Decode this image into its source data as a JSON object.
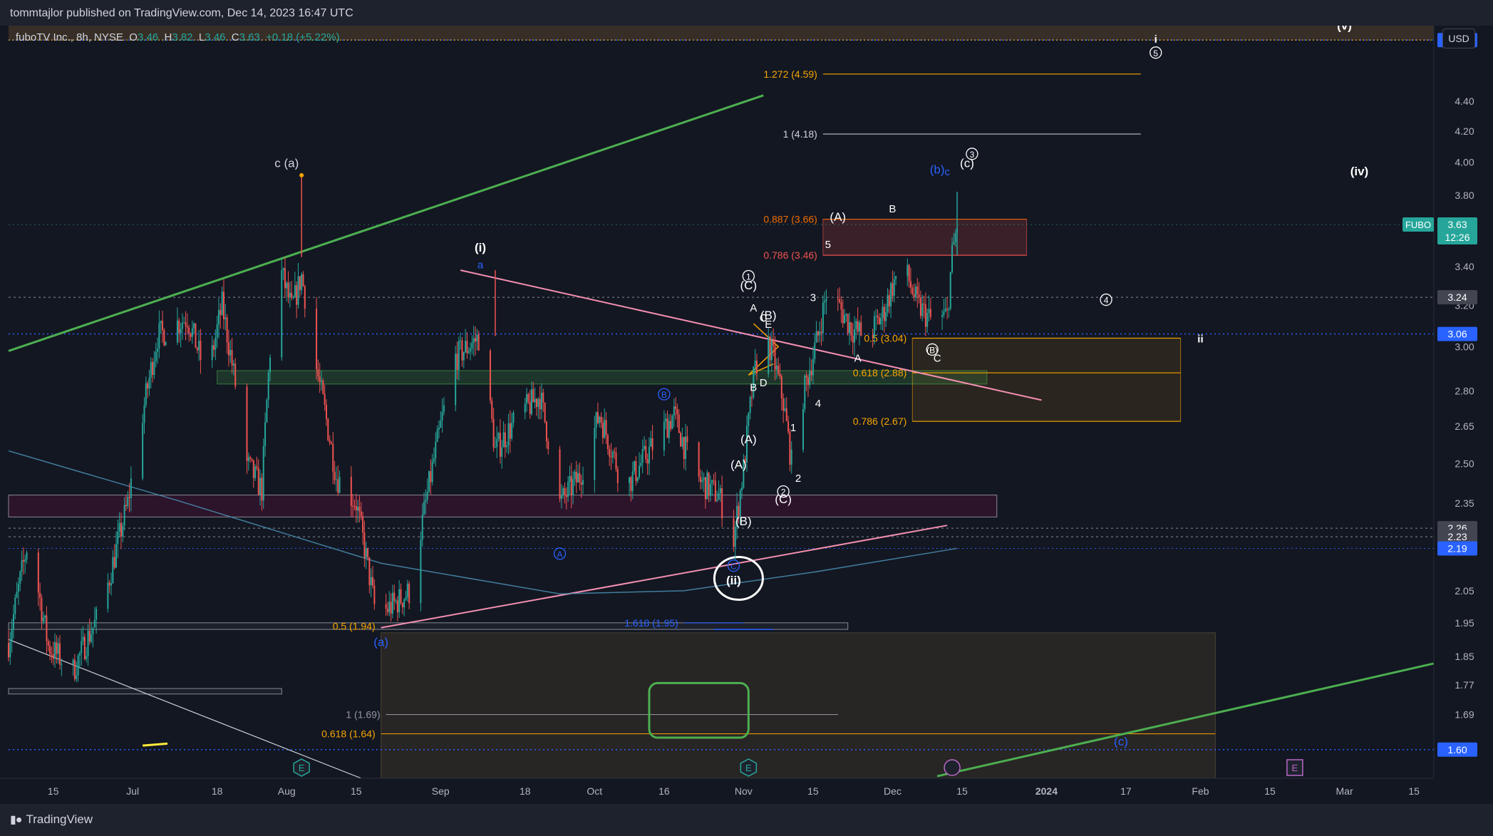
{
  "header": {
    "published": "tommtajlor published on TradingView.com, Dec 14, 2023 16:47 UTC"
  },
  "legend": {
    "name": "fuboTV Inc., 8h, NYSE",
    "open_label": "O",
    "open": "3.46",
    "high_label": "H",
    "high": "3.82",
    "low_label": "L",
    "low": "3.46",
    "close_label": "C",
    "close": "3.63",
    "change": "+0.18 (+5.22%)"
  },
  "currency": "USD",
  "footer": {
    "brand": "TradingView"
  },
  "colors": {
    "background": "#131722",
    "up": "#26a69a",
    "down": "#ef5350",
    "blue": "#2962ff",
    "orange": "#f7a600",
    "green": "#4caf50",
    "pink": "#f48fb1"
  },
  "chart_data": {
    "type": "candlestick",
    "symbol": "FUBO",
    "timeframe": "8h",
    "grid": false,
    "y_axis": {
      "scale": "log",
      "range": [
        1.53,
        4.95
      ],
      "ticks": [
        "4.40",
        "4.20",
        "4.00",
        "3.80",
        "3.40",
        "3.20",
        "3.00",
        "2.80",
        "2.65",
        "2.50",
        "2.35",
        "2.05",
        "1.95",
        "1.85",
        "1.77",
        "1.69"
      ]
    },
    "x_axis": {
      "range": [
        "2023-06-06",
        "2024-03-19"
      ],
      "ticks": [
        {
          "label": "15",
          "date": "2023-06-15"
        },
        {
          "label": "Jul",
          "date": "2023-07-01"
        },
        {
          "label": "18",
          "date": "2023-07-18"
        },
        {
          "label": "Aug",
          "date": "2023-08-01"
        },
        {
          "label": "15",
          "date": "2023-08-15"
        },
        {
          "label": "Sep",
          "date": "2023-09-01"
        },
        {
          "label": "18",
          "date": "2023-09-18"
        },
        {
          "label": "Oct",
          "date": "2023-10-02"
        },
        {
          "label": "16",
          "date": "2023-10-16"
        },
        {
          "label": "Nov",
          "date": "2023-11-01"
        },
        {
          "label": "15",
          "date": "2023-11-15"
        },
        {
          "label": "Dec",
          "date": "2023-12-01"
        },
        {
          "label": "15",
          "date": "2023-12-15"
        },
        {
          "label": "2024",
          "date": "2024-01-01",
          "bold": true
        },
        {
          "label": "17",
          "date": "2024-01-17"
        },
        {
          "label": "Feb",
          "date": "2024-02-01"
        },
        {
          "label": "15",
          "date": "2024-02-15"
        },
        {
          "label": "Mar",
          "date": "2024-03-01"
        },
        {
          "label": "15",
          "date": "2024-03-15"
        }
      ]
    },
    "price_path": [
      [
        "2023-06-06",
        1.89
      ],
      [
        "2023-06-10",
        2.22
      ],
      [
        "2023-06-14",
        1.88
      ],
      [
        "2023-06-19",
        1.81
      ],
      [
        "2023-06-25",
        2.0
      ],
      [
        "2023-06-30",
        2.35
      ],
      [
        "2023-07-06",
        3.05
      ],
      [
        "2023-07-12",
        3.14
      ],
      [
        "2023-07-16",
        2.85
      ],
      [
        "2023-07-19",
        3.2
      ],
      [
        "2023-07-24",
        2.5
      ],
      [
        "2023-07-27",
        2.4
      ],
      [
        "2023-07-30",
        3.45
      ],
      [
        "2023-08-02",
        3.18
      ],
      [
        "2023-08-04",
        3.35
      ],
      [
        "2023-08-07",
        2.9
      ],
      [
        "2023-08-11",
        2.45
      ],
      [
        "2023-08-15",
        2.35
      ],
      [
        "2023-08-19",
        1.97
      ],
      [
        "2023-08-22",
        2.0
      ],
      [
        "2023-08-26",
        2.05
      ],
      [
        "2023-08-29",
        2.35
      ],
      [
        "2023-09-04",
        2.95
      ],
      [
        "2023-09-09",
        3.05
      ],
      [
        "2023-09-12",
        2.55
      ],
      [
        "2023-09-17",
        2.7
      ],
      [
        "2023-09-21",
        2.78
      ],
      [
        "2023-09-25",
        2.35
      ],
      [
        "2023-09-29",
        2.45
      ],
      [
        "2023-10-03",
        2.7
      ],
      [
        "2023-10-08",
        2.4
      ],
      [
        "2023-10-13",
        2.55
      ],
      [
        "2023-10-18",
        2.7
      ],
      [
        "2023-10-22",
        2.45
      ],
      [
        "2023-10-27",
        2.38
      ],
      [
        "2023-10-30",
        2.22
      ],
      [
        "2023-11-01",
        2.48
      ],
      [
        "2023-11-03",
        2.85
      ],
      [
        "2023-11-05",
        3.08
      ],
      [
        "2023-11-07",
        2.95
      ],
      [
        "2023-11-09",
        2.75
      ],
      [
        "2023-11-11",
        2.45
      ],
      [
        "2023-11-13",
        2.78
      ],
      [
        "2023-11-16",
        3.05
      ],
      [
        "2023-11-18",
        3.3
      ],
      [
        "2023-11-20",
        3.2
      ],
      [
        "2023-11-23",
        3.08
      ],
      [
        "2023-11-26",
        3.05
      ],
      [
        "2023-11-29",
        3.15
      ],
      [
        "2023-12-01",
        3.3
      ],
      [
        "2023-12-03",
        3.42
      ],
      [
        "2023-12-06",
        3.2
      ],
      [
        "2023-12-09",
        3.12
      ],
      [
        "2023-12-12",
        3.15
      ],
      [
        "2023-12-13",
        3.46
      ],
      [
        "2023-12-14",
        3.63
      ]
    ],
    "series": [
      {
        "name": "FUBO",
        "last": "3.63"
      }
    ],
    "price_labels": [
      {
        "value": 4.84,
        "text": "4.84",
        "style": "blue"
      },
      {
        "value": 3.63,
        "text": "3.63",
        "sub": "12:26",
        "style": "green"
      },
      {
        "value": 3.24,
        "text": "3.24",
        "style": "gray"
      },
      {
        "value": 3.06,
        "text": "3.06",
        "style": "blue"
      },
      {
        "value": 2.26,
        "text": "2.26",
        "style": "gray"
      },
      {
        "value": 2.23,
        "text": "2.23",
        "style": "gray"
      },
      {
        "value": 2.19,
        "text": "2.19",
        "style": "lightblue"
      },
      {
        "value": 1.6,
        "text": "1.60",
        "style": "blue"
      }
    ],
    "fib_levels": [
      {
        "text": "1.272 (4.59)",
        "value": 4.59,
        "color": "#f7a600",
        "from": "2023-11-17",
        "to": "2024-01-20"
      },
      {
        "text": "1 (4.18)",
        "value": 4.18,
        "color": "#d1d4dc",
        "from": "2023-11-17",
        "to": "2024-01-20"
      },
      {
        "text": "0.887 (3.66)",
        "value": 3.66,
        "color": "#ef6c00",
        "from": "2023-11-17",
        "to": "2023-12-28"
      },
      {
        "text": "0.786 (3.46)",
        "value": 3.46,
        "color": "#ef5350",
        "from": "2023-11-17",
        "to": "2023-12-28"
      },
      {
        "text": "0.5 (3.04)",
        "value": 3.04,
        "color": "#f7a600",
        "from": "2023-12-05",
        "to": "2024-01-28"
      },
      {
        "text": "0.618 (2.88)",
        "value": 2.88,
        "color": "#f7a600",
        "from": "2023-12-05",
        "to": "2024-01-28"
      },
      {
        "text": "0.786 (2.67)",
        "value": 2.67,
        "color": "#f7a600",
        "from": "2023-12-05",
        "to": "2024-01-28"
      },
      {
        "text": "0.5 (1.94)",
        "value": 1.94,
        "color": "#f7a600",
        "from": "2023-08-20",
        "to": "2023-08-20"
      },
      {
        "text": "1.618 (1.95)",
        "value": 1.95,
        "color": "#2962ff",
        "from": "2023-10-20",
        "to": "2023-11-01"
      },
      {
        "text": "1 (1.69)",
        "value": 1.69,
        "color": "#9598a1",
        "from": "2023-08-21",
        "to": "2023-11-20"
      },
      {
        "text": "0.618 (1.64)",
        "value": 1.64,
        "color": "#f7a600",
        "from": "2023-08-20",
        "to": "2024-02-04"
      }
    ],
    "wave_labels": [
      {
        "text": "(v)",
        "date": "2024-03-01",
        "value": 4.92,
        "color": "#ffffff"
      },
      {
        "text": "i",
        "date": "2024-01-23",
        "value": 4.82,
        "color": "#ffffff"
      },
      {
        "text": "5",
        "date": "2024-01-23",
        "value": 4.72,
        "color": "#ffffff",
        "circle": true
      },
      {
        "text": "c (a)",
        "date": "2023-08-01",
        "value": 3.97,
        "color": "#d1d4dc"
      },
      {
        "text": "(iv)",
        "date": "2024-03-04",
        "value": 3.92,
        "color": "#ffffff"
      },
      {
        "text": "(b)",
        "date": "2023-12-10",
        "value": 3.93,
        "color": "#2962ff"
      },
      {
        "text": "c",
        "date": "2023-12-12",
        "value": 3.92,
        "color": "#2962ff"
      },
      {
        "text": "(c)",
        "date": "2023-12-16",
        "value": 3.97,
        "color": "#ffffff"
      },
      {
        "text": "3",
        "date": "2023-12-17",
        "value": 4.03,
        "color": "#ffffff",
        "circle": true
      },
      {
        "text": "(i)",
        "date": "2023-09-09",
        "value": 3.48,
        "color": "#ffffff"
      },
      {
        "text": "a",
        "date": "2023-09-09",
        "value": 3.39,
        "color": "#2962ff"
      },
      {
        "text": "1",
        "date": "2023-11-02",
        "value": 3.33,
        "color": "#ffffff",
        "circle": true
      },
      {
        "text": "(C)",
        "date": "2023-11-02",
        "value": 3.28,
        "color": "#ffffff"
      },
      {
        "text": "A",
        "date": "2023-11-03",
        "value": 3.17,
        "color": "#ffffff"
      },
      {
        "text": "C",
        "date": "2023-11-05",
        "value": 3.12,
        "color": "#ffffff"
      },
      {
        "text": "(B)",
        "date": "2023-11-06",
        "value": 3.13,
        "color": "#ffffff"
      },
      {
        "text": "E",
        "date": "2023-11-06",
        "value": 3.09,
        "color": "#ffffff"
      },
      {
        "text": "B",
        "date": "2023-11-03",
        "value": 2.8,
        "color": "#ffffff"
      },
      {
        "text": "D",
        "date": "2023-11-05",
        "value": 2.82,
        "color": "#ffffff"
      },
      {
        "text": "3",
        "date": "2023-11-15",
        "value": 3.22,
        "color": "#ffffff"
      },
      {
        "text": "5",
        "date": "2023-11-18",
        "value": 3.5,
        "color": "#ffffff"
      },
      {
        "text": "(A)",
        "date": "2023-11-20",
        "value": 3.65,
        "color": "#ffffff"
      },
      {
        "text": "B",
        "date": "2023-12-01",
        "value": 3.7,
        "color": "#ffffff"
      },
      {
        "text": "4",
        "date": "2024-01-13",
        "value": 3.21,
        "color": "#ffffff",
        "circle": true
      },
      {
        "text": "ii",
        "date": "2024-02-01",
        "value": 3.02,
        "color": "#ffffff"
      },
      {
        "text": "(B)",
        "date": "2023-12-09",
        "value": 2.97,
        "color": "#ffffff",
        "circle": true
      },
      {
        "text": "C",
        "date": "2023-12-10",
        "value": 2.93,
        "color": "#ffffff"
      },
      {
        "text": "A",
        "date": "2023-11-24",
        "value": 2.93,
        "color": "#ffffff"
      },
      {
        "text": "4",
        "date": "2023-11-16",
        "value": 2.73,
        "color": "#ffffff"
      },
      {
        "text": "1",
        "date": "2023-11-11",
        "value": 2.63,
        "color": "#ffffff"
      },
      {
        "text": "2",
        "date": "2023-11-12",
        "value": 2.43,
        "color": "#ffffff"
      },
      {
        "text": "2",
        "date": "2023-11-09",
        "value": 2.38,
        "color": "#ffffff",
        "circle": true
      },
      {
        "text": "(C)",
        "date": "2023-11-09",
        "value": 2.35,
        "color": "#ffffff"
      },
      {
        "text": "(A)",
        "date": "2023-11-02",
        "value": 2.58,
        "color": "#ffffff"
      },
      {
        "text": "(A)",
        "date": "2023-10-31",
        "value": 2.48,
        "color": "#ffffff"
      },
      {
        "text": "(B)",
        "date": "2023-11-01",
        "value": 2.27,
        "color": "#ffffff"
      },
      {
        "text": "B",
        "date": "2023-10-16",
        "value": 2.77,
        "color": "#2962ff",
        "circle": true
      },
      {
        "text": "A",
        "date": "2023-09-25",
        "value": 2.16,
        "color": "#2962ff",
        "circle": true
      },
      {
        "text": "C",
        "date": "2023-10-30",
        "value": 2.12,
        "color": "#2962ff",
        "circle": true
      },
      {
        "text": "(ii)",
        "date": "2023-10-30",
        "value": 2.07,
        "color": "#ffffff"
      },
      {
        "text": "(a)",
        "date": "2023-08-20",
        "value": 1.88,
        "color": "#2962ff"
      },
      {
        "text": "(c)",
        "date": "2024-01-16",
        "value": 1.61,
        "color": "#2962ff"
      }
    ],
    "events": [
      {
        "text": "E",
        "date": "2023-08-04",
        "kind": "earnings-teal"
      },
      {
        "text": "E",
        "date": "2023-11-02",
        "kind": "earnings-teal"
      },
      {
        "text": "E",
        "date": "2024-02-20",
        "kind": "earnings-purple"
      }
    ]
  }
}
